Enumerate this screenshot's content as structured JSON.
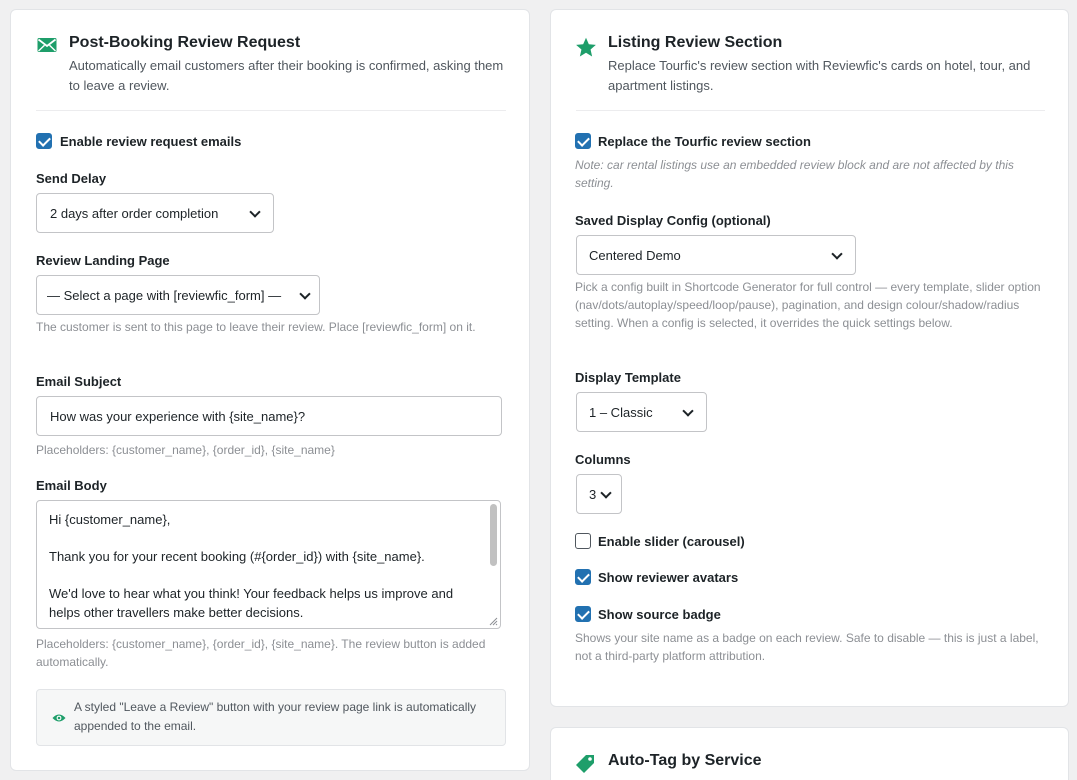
{
  "post_booking": {
    "icon": "envelope-icon",
    "title": "Post-Booking Review Request",
    "description": "Automatically email customers after their booking is confirmed, asking them to leave a review.",
    "enable_label": "Enable review request emails",
    "enable_checked": true,
    "send_delay": {
      "label": "Send Delay",
      "value": "2 days after order completion"
    },
    "landing_page": {
      "label": "Review Landing Page",
      "value": "— Select a page with [reviewfic_form] —",
      "help": "The customer is sent to this page to leave their review. Place [reviewfic_form] on it."
    },
    "email_subject": {
      "label": "Email Subject",
      "value": "How was your experience with {site_name}?",
      "help": "Placeholders: {customer_name}, {order_id}, {site_name}"
    },
    "email_body": {
      "label": "Email Body",
      "line1": "Hi {customer_name},",
      "line2": "Thank you for your recent booking (#{order_id}) with {site_name}.",
      "line3": "We'd love to hear what you think! Your feedback helps us improve and helps other travellers make better decisions.",
      "help": "Placeholders: {customer_name}, {order_id}, {site_name}. The review button is added automatically."
    },
    "info": {
      "icon": "eye-icon",
      "text": "A styled \"Leave a Review\" button with your review page link is automatically appended to the email."
    }
  },
  "listing_review": {
    "icon": "star-icon",
    "title": "Listing Review Section",
    "description": "Replace Tourfic's review section with Reviewfic's cards on hotel, tour, and apartment listings.",
    "replace_label": "Replace the Tourfic review section",
    "replace_checked": true,
    "note": "Note: car rental listings use an embedded review block and are not affected by this setting.",
    "saved_config": {
      "label": "Saved Display Config (optional)",
      "value": "Centered Demo",
      "help": "Pick a config built in Shortcode Generator for full control — every template, slider option (nav/dots/autoplay/speed/loop/pause), pagination, and design colour/shadow/radius setting. When a config is selected, it overrides the quick settings below."
    },
    "display_template": {
      "label": "Display Template",
      "value": "1 – Classic"
    },
    "columns": {
      "label": "Columns",
      "value": "3"
    },
    "slider_label": "Enable slider (carousel)",
    "slider_checked": false,
    "avatars_label": "Show reviewer avatars",
    "avatars_checked": true,
    "badge_label": "Show source badge",
    "badge_checked": true,
    "badge_help": "Shows your site name as a badge on each review. Safe to disable — this is just a label, not a third-party platform attribution."
  },
  "auto_tag": {
    "icon": "tag-icon",
    "title": "Auto-Tag by Service"
  },
  "colors": {
    "primary_blue": "#2271b1",
    "accent_green": "#1e9e6a"
  }
}
